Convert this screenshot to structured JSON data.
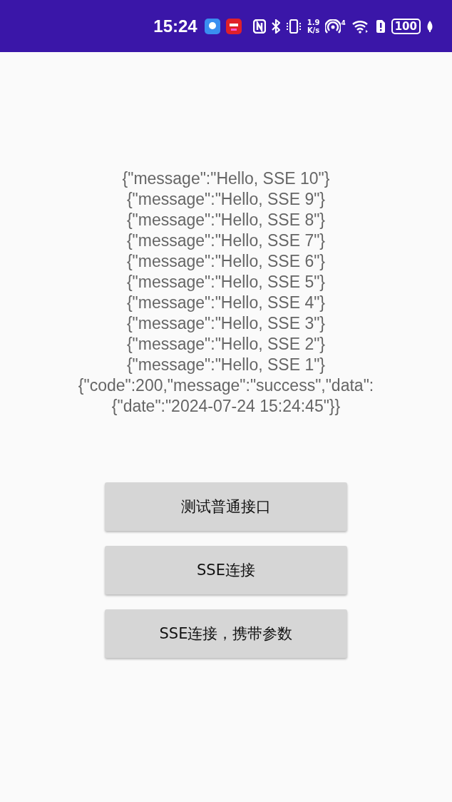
{
  "status_bar": {
    "time": "15:24",
    "speed_value": "1.9",
    "speed_unit": "K/s",
    "hotspot_count": "4",
    "battery": "100"
  },
  "log_lines": [
    "{\"message\":\"Hello, SSE 10\"}",
    "{\"message\":\"Hello, SSE 9\"}",
    "{\"message\":\"Hello, SSE 8\"}",
    "{\"message\":\"Hello, SSE 7\"}",
    "{\"message\":\"Hello, SSE 6\"}",
    "{\"message\":\"Hello, SSE 5\"}",
    "{\"message\":\"Hello, SSE 4\"}",
    "{\"message\":\"Hello, SSE 3\"}",
    "{\"message\":\"Hello, SSE 2\"}",
    "{\"message\":\"Hello, SSE 1\"}",
    "{\"code\":200,\"message\":\"success\",\"data\":",
    "{\"date\":\"2024-07-24 15:24:45\"}}"
  ],
  "buttons": [
    "测试普通接口",
    "SSE连接",
    "SSE连接，携带参数"
  ]
}
